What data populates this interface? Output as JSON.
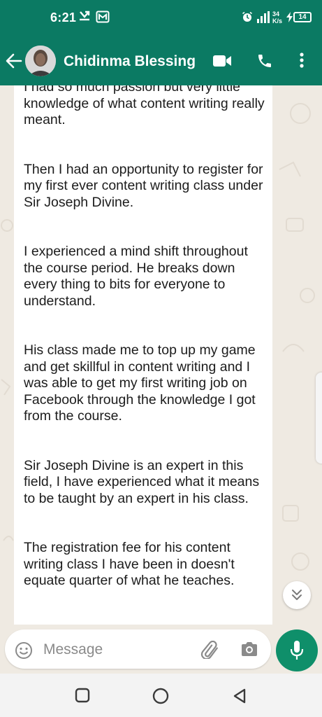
{
  "status_bar": {
    "time": "6:21",
    "network_speed_value": "34",
    "network_speed_unit": "K/s",
    "battery": "14"
  },
  "header": {
    "contact_name": "Chidinma Blessing",
    "icons": [
      "back-arrow-icon",
      "video-call-icon",
      "phone-icon",
      "more-vert-icon"
    ]
  },
  "chat": {
    "message_paragraphs": [
      "I had so much passion but very little knowledge of what content writing really meant.",
      "Then I had an opportunity to register for my first ever content writing class under Sir Joseph Divine.",
      "I experienced a mind shift throughout the course period. He breaks down every thing to bits for everyone to understand.",
      "His class made me to top up my game and get skillful in content writing and I was able to get my first writing job on Facebook through the knowledge I got from the course.",
      "Sir Joseph Divine is an expert in this field, I have experienced what it means to be taught by an expert in his class.",
      "The registration fee for his content writing class I have been in doesn't equate quarter of what he teaches."
    ]
  },
  "composer": {
    "placeholder": "Message",
    "icons": [
      "emoji-icon",
      "attach-icon",
      "camera-icon",
      "mic-icon"
    ]
  },
  "colors": {
    "header": "#0b7a63",
    "accent": "#0f8f6a",
    "chat_background": "#efeae2",
    "bubble": "#ffffff"
  }
}
